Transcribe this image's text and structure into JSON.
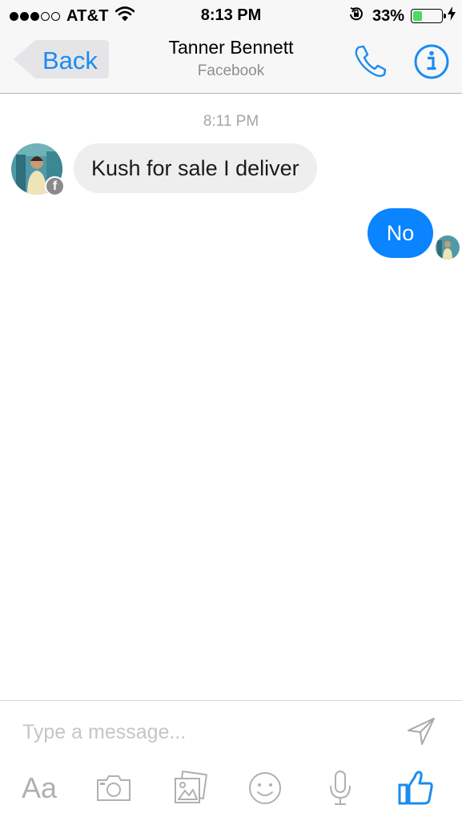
{
  "status_bar": {
    "carrier": "AT&T",
    "time": "8:13 PM",
    "battery_percent_label": "33%",
    "battery_level": 0.33
  },
  "nav": {
    "back_label": "Back",
    "contact_name": "Tanner Bennett",
    "contact_subtitle": "Facebook"
  },
  "conversation": {
    "timestamp": "8:11 PM",
    "messages": [
      {
        "from": "contact",
        "text": "Kush for sale I deliver"
      },
      {
        "from": "me",
        "text": "No"
      }
    ]
  },
  "composer": {
    "placeholder": "Type a message...",
    "aa_label": "Aa"
  },
  "colors": {
    "accent": "#1a8cf0",
    "outgoing_bubble": "#0a84ff",
    "incoming_bubble": "#eeeeef",
    "battery_fill": "#4cd964"
  },
  "icons": [
    "wifi-icon",
    "rotation-lock-icon",
    "charging-icon",
    "phone-icon",
    "info-icon",
    "facebook-badge-icon",
    "send-icon",
    "camera-icon",
    "gallery-icon",
    "emoji-icon",
    "microphone-icon",
    "like-icon"
  ]
}
